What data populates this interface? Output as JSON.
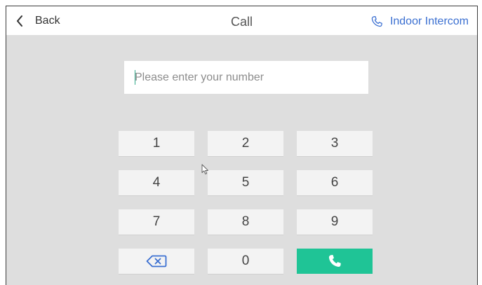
{
  "header": {
    "back_label": "Back",
    "title": "Call",
    "intercom_label": "Indoor Intercom",
    "accent_color": "#3a6fd1"
  },
  "input": {
    "placeholder": "Please enter your number",
    "value": ""
  },
  "keypad": {
    "keys": [
      "1",
      "2",
      "3",
      "4",
      "5",
      "6",
      "7",
      "8",
      "9",
      "0"
    ],
    "delete_icon": "backspace-icon",
    "call_icon": "phone-icon",
    "call_color": "#1fc496"
  }
}
